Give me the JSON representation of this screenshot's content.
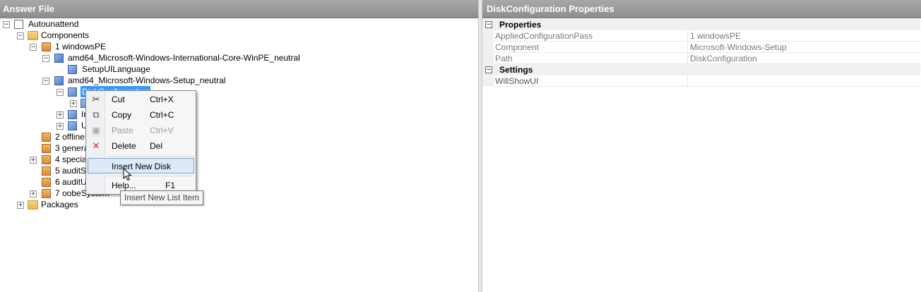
{
  "left_panel": {
    "title": "Answer File"
  },
  "right_panel": {
    "title": "DiskConfiguration Properties"
  },
  "tree": {
    "root": "Autounattend",
    "components": "Components",
    "pass1": "1 windowsPE",
    "comp_intl": "amd64_Microsoft-Windows-International-Core-WinPE_neutral",
    "setup_ui_language": "SetupUILanguage",
    "comp_setup": "amd64_Microsoft-Windows-Setup_neutral",
    "disk_configuration": "DiskConfiguration",
    "child_in": "In",
    "child_u": "U",
    "pass2": "2 offlineS",
    "pass3": "3 general",
    "pass4": "4 speciali",
    "pass5": "5 auditSy",
    "pass6": "6 auditUs",
    "pass7": "7 oobeSystem",
    "packages": "Packages"
  },
  "context_menu": {
    "cut": {
      "label": "Cut",
      "shortcut": "Ctrl+X",
      "icon": "scissors-icon"
    },
    "copy": {
      "label": "Copy",
      "shortcut": "Ctrl+C",
      "icon": "copy-icon"
    },
    "paste": {
      "label": "Paste",
      "shortcut": "Ctrl+V",
      "icon": "paste-icon"
    },
    "delete": {
      "label": "Delete",
      "shortcut": "Del",
      "icon": "delete-icon"
    },
    "insert_new_disk": {
      "label": "Insert New Disk"
    },
    "help": {
      "label": "Help...",
      "shortcut": "F1"
    }
  },
  "tooltip": "Insert New List Item",
  "properties": {
    "category_properties": "Properties",
    "category_settings": "Settings",
    "rows": [
      {
        "name": "AppliedConfigurationPass",
        "value": "1 windowsPE"
      },
      {
        "name": "Component",
        "value": "Microsoft-Windows-Setup"
      },
      {
        "name": "Path",
        "value": "DiskConfiguration"
      }
    ],
    "settings_rows": [
      {
        "name": "WillShowUI",
        "value": ""
      }
    ]
  },
  "colors": {
    "selection": "#3399ff",
    "title_bar": "#9a9a9a",
    "menu_hover": "#dce9f9"
  }
}
